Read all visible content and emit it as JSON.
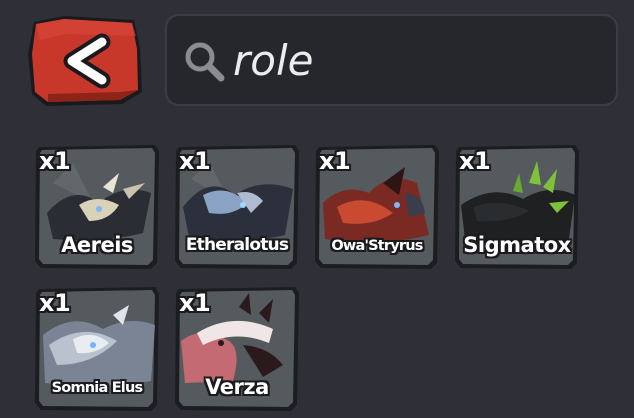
{
  "header": {
    "back_icon": "chevron-left-icon",
    "search": {
      "value": "role",
      "icon": "search-icon"
    }
  },
  "inventory": {
    "items": [
      {
        "quantity": "x1",
        "name": "Aereis",
        "palette": [
          "#3a3d44",
          "#d9d2b8",
          "#20232a"
        ]
      },
      {
        "quantity": "x1",
        "name": "Etheralotus",
        "palette": [
          "#2c2f3c",
          "#8aa2c4",
          "#1c1e26"
        ]
      },
      {
        "quantity": "x1",
        "name": "Owa'Stryrus",
        "palette": [
          "#7a2a22",
          "#c84a30",
          "#2e1414"
        ]
      },
      {
        "quantity": "x1",
        "name": "Sigmatox",
        "palette": [
          "#1e2022",
          "#7fc23a",
          "#101214"
        ]
      },
      {
        "quantity": "x1",
        "name": "Somnia Elus",
        "palette": [
          "#b9c2ce",
          "#e8edf2",
          "#7a8494"
        ]
      },
      {
        "quantity": "x1",
        "name": "Verza",
        "palette": [
          "#c46a72",
          "#f0e6e6",
          "#2a1a1c"
        ]
      }
    ]
  },
  "colors": {
    "background": "#2f3037",
    "back_button": "#c8382a",
    "card_bg": "#44474c",
    "card_border": "#1c1d21"
  }
}
